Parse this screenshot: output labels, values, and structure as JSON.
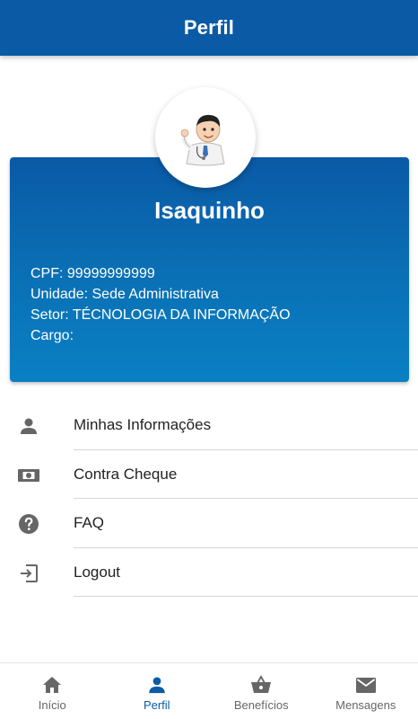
{
  "header": {
    "title": "Perfil"
  },
  "profile": {
    "name": "Isaquinho",
    "cpf": "CPF: 99999999999",
    "unidade": "Unidade: Sede Administrativa",
    "setor": "Setor: TÉCNOLOGIA DA INFORMAÇÃO",
    "cargo": "Cargo:"
  },
  "menu": {
    "items": [
      {
        "label": "Minhas Informações",
        "icon": "person-icon"
      },
      {
        "label": "Contra Cheque",
        "icon": "money-icon"
      },
      {
        "label": "FAQ",
        "icon": "help-icon"
      },
      {
        "label": "Logout",
        "icon": "logout-icon"
      }
    ]
  },
  "bottom_nav": {
    "items": [
      {
        "label": "Início",
        "icon": "home-icon"
      },
      {
        "label": "Perfil",
        "icon": "person-icon",
        "active": true
      },
      {
        "label": "Benefícios",
        "icon": "basket-icon"
      },
      {
        "label": "Mensagens",
        "icon": "mail-icon"
      }
    ]
  },
  "colors": {
    "primary": "#0a5aa6",
    "card_gradient_end": "#0a80c4",
    "icon_gray": "#666666"
  }
}
